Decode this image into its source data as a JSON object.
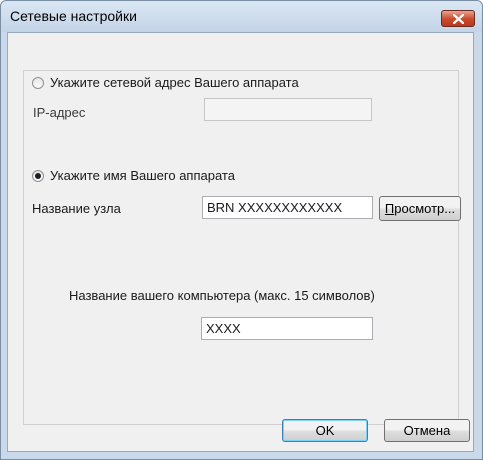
{
  "window": {
    "title": "Сетевые настройки"
  },
  "address_option": {
    "label": "Укажите сетевой адрес Вашего аппарата",
    "checked": false,
    "ip_label": "IP-адрес",
    "ip_value": ""
  },
  "name_option": {
    "label": "Укажите имя  Вашего аппарата",
    "checked": true,
    "node_label": "Название узла",
    "node_value": "BRN XXXXXXXXXXXX",
    "browse_button_first": "П",
    "browse_button_rest": "росмотр..."
  },
  "computer": {
    "label": "Название вашего компьютера (макс. 15 символов)",
    "value": "XXXX"
  },
  "buttons": {
    "ok": "OK",
    "cancel": "Отмена"
  },
  "icons": {
    "close": "close-icon"
  },
  "colors": {
    "title_bar": "#c9d9ea",
    "close_button": "#c9482c",
    "dialog_background": "#f0f0f0"
  }
}
